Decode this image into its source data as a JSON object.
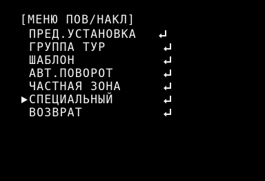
{
  "menu": {
    "title": "[МЕНЮ ПОВ/НАКЛ]",
    "items": [
      {
        "label": "ПРЕД.УСТАНОВКА",
        "icon": "enter-icon",
        "selected": false
      },
      {
        "label": "ГРУППА ТУР",
        "icon": "enter-icon",
        "selected": false
      },
      {
        "label": "ШАБЛОН",
        "icon": "enter-icon",
        "selected": false
      },
      {
        "label": "АВТ.ПОВОРОТ",
        "icon": "enter-icon",
        "selected": false
      },
      {
        "label": "ЧАСТНАЯ ЗОНА",
        "icon": "enter-icon",
        "selected": false
      },
      {
        "label": "СПЕЦИАЛЬНЫЙ",
        "icon": "enter-icon",
        "selected": true
      },
      {
        "label": "ВОЗВРАТ",
        "icon": "enter-icon",
        "selected": false
      }
    ]
  },
  "colors": {
    "background": "#000000",
    "text": "#f2f2f2"
  }
}
